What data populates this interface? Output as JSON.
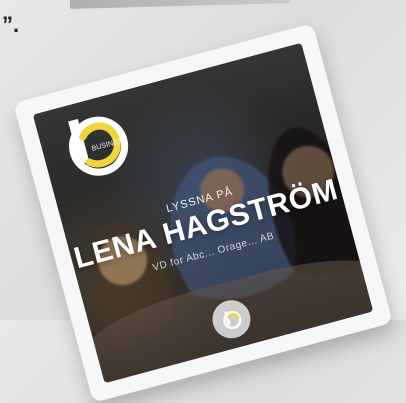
{
  "colors": {
    "accent_yellow": "#f0d53a",
    "logo_white": "#ffffff"
  },
  "top": {
    "quote_mark": "”."
  },
  "card": {
    "pre_title": "LYSSNA PÅ",
    "name": "LENA HAGSTRÖM",
    "role": "VD for Abc... Orage... AB",
    "logo_icon": "b-logo",
    "logo_small_text": "BUSINESS",
    "bottom_logo_icon": "b-mini-logo"
  }
}
